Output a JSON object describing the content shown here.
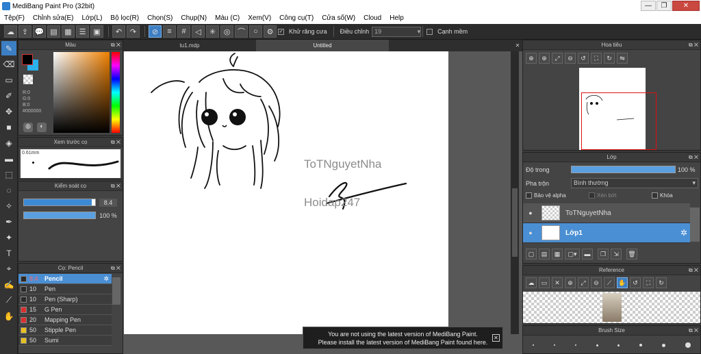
{
  "window": {
    "title": "MediBang Paint Pro (32bit)",
    "min": "—",
    "max": "❐",
    "close": "✕"
  },
  "menu": [
    "Tệp(F)",
    "Chỉnh sửa(E)",
    "Lớp(L)",
    "Bộ lọc(R)",
    "Chọn(S)",
    "Chụp(N)",
    "Màu (C)",
    "Xem(V)",
    "Công cụ(T)",
    "Cửa số(W)",
    "Cloud",
    "Help"
  ],
  "toolbar": {
    "antialias_label": "Khử răng cưa",
    "adjust_label": "Điều chỉnh",
    "adjust_value": "19",
    "snap_label": "Cạnh mềm"
  },
  "color_panel": {
    "title": "Màu",
    "r": "R:0",
    "g": "G:0",
    "b": "B:0",
    "hex": "#000000"
  },
  "brush_preview": {
    "title": "Xem trước cọ",
    "size": "0.61mm"
  },
  "brush_control": {
    "title": "Kiểm soát cọ",
    "size_value": "8.4",
    "opacity_value": "100 %",
    "size_fill": 0.95,
    "opacity_fill": 1.0
  },
  "brush_list": {
    "title": "Cọ: Pencil",
    "items": [
      {
        "size": "8.4",
        "name": "Pencil",
        "color": "#2a2a2a",
        "selected": true
      },
      {
        "size": "10",
        "name": "Pen",
        "color": "#2a2a2a"
      },
      {
        "size": "10",
        "name": "Pen (Sharp)",
        "color": "#2a2a2a"
      },
      {
        "size": "15",
        "name": "G Pen",
        "color": "#d93030"
      },
      {
        "size": "20",
        "name": "Mapping Pen",
        "color": "#d93030"
      },
      {
        "size": "50",
        "name": "Stipple Pen",
        "color": "#e8c020"
      },
      {
        "size": "50",
        "name": "Sumi",
        "color": "#e8c020"
      }
    ]
  },
  "tabs": [
    "tu1.mdp",
    "Untitled"
  ],
  "canvas": {
    "watermark1": "ToTNguyetNha",
    "watermark2": "Hoidap247"
  },
  "notice": {
    "line1": "You are not using the latest version of MediBang Paint.",
    "line2": "Please install the latest version of MediBang Paint found here.",
    "close": "✕"
  },
  "navigator": {
    "title": "Hoa tiêu"
  },
  "layers": {
    "title": "Lớp",
    "opacity_label": "Độ trong",
    "opacity_value": "100 %",
    "opacity_fill": 1.0,
    "blend_label": "Pha trộn",
    "blend_value": "Bình thường",
    "protect_alpha": "Bảo vệ alpha",
    "clipping": "Xén bớt",
    "lock": "Khóa",
    "items": [
      {
        "name": "ToTNguyetNha",
        "selected": false
      },
      {
        "name": "Lớp1",
        "selected": true
      }
    ]
  },
  "reference": {
    "title": "Reference"
  },
  "brush_size": {
    "title": "Brush Size"
  }
}
